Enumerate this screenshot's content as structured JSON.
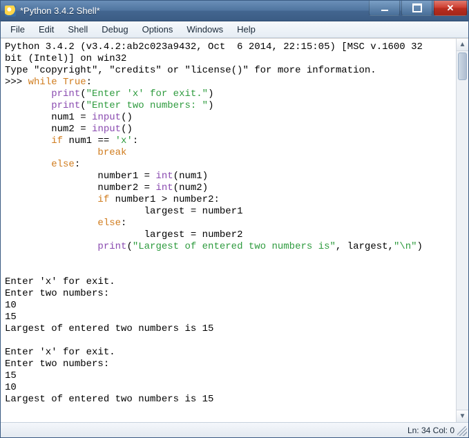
{
  "titlebar": {
    "title": "*Python 3.4.2 Shell*"
  },
  "menu": {
    "file": "File",
    "edit": "Edit",
    "shell": "Shell",
    "debug": "Debug",
    "options": "Options",
    "windows": "Windows",
    "help": "Help"
  },
  "banner": {
    "l1": "Python 3.4.2 (v3.4.2:ab2c023a9432, Oct  6 2014, 22:15:05) [MSC v.1600 32",
    "l2": "bit (Intel)] on win32",
    "l3": "Type \"copyright\", \"credits\" or \"license()\" for more information."
  },
  "prompt": ">>> ",
  "code": {
    "kw_while": "while",
    "kw_true": "True",
    "colon": ":",
    "print": "print",
    "s_exit": "\"Enter 'x' for exit.\"",
    "s_two": "\"Enter two numbers: \"",
    "num1": "num1",
    "num2": "num2",
    "eq": " = ",
    "input": "input",
    "paren": "()",
    "kw_if": "if",
    "cmp": " == ",
    "s_x": "'x'",
    "kw_break": "break",
    "kw_else": "else",
    "number1": "number1",
    "number2": "number2",
    "int": "int",
    "lp": "(",
    "rp": ")",
    "gt": " > ",
    "largest": "largest",
    "eq2": " = ",
    "s_largest": "\"Largest of entered two numbers is\"",
    "comma": ", ",
    "nl": "\"\\n\""
  },
  "output": {
    "blank": "",
    "p1l1": "Enter 'x' for exit.",
    "p1l2": "Enter two numbers:",
    "p1v1": "10",
    "p1v2": "15",
    "p1res": "Largest of entered two numbers is 15",
    "p2l1": "Enter 'x' for exit.",
    "p2l2": "Enter two numbers:",
    "p2v1": "15",
    "p2v2": "10",
    "p2res": "Largest of entered two numbers is 15"
  },
  "status": {
    "pos": "Ln: 34 Col: 0"
  }
}
